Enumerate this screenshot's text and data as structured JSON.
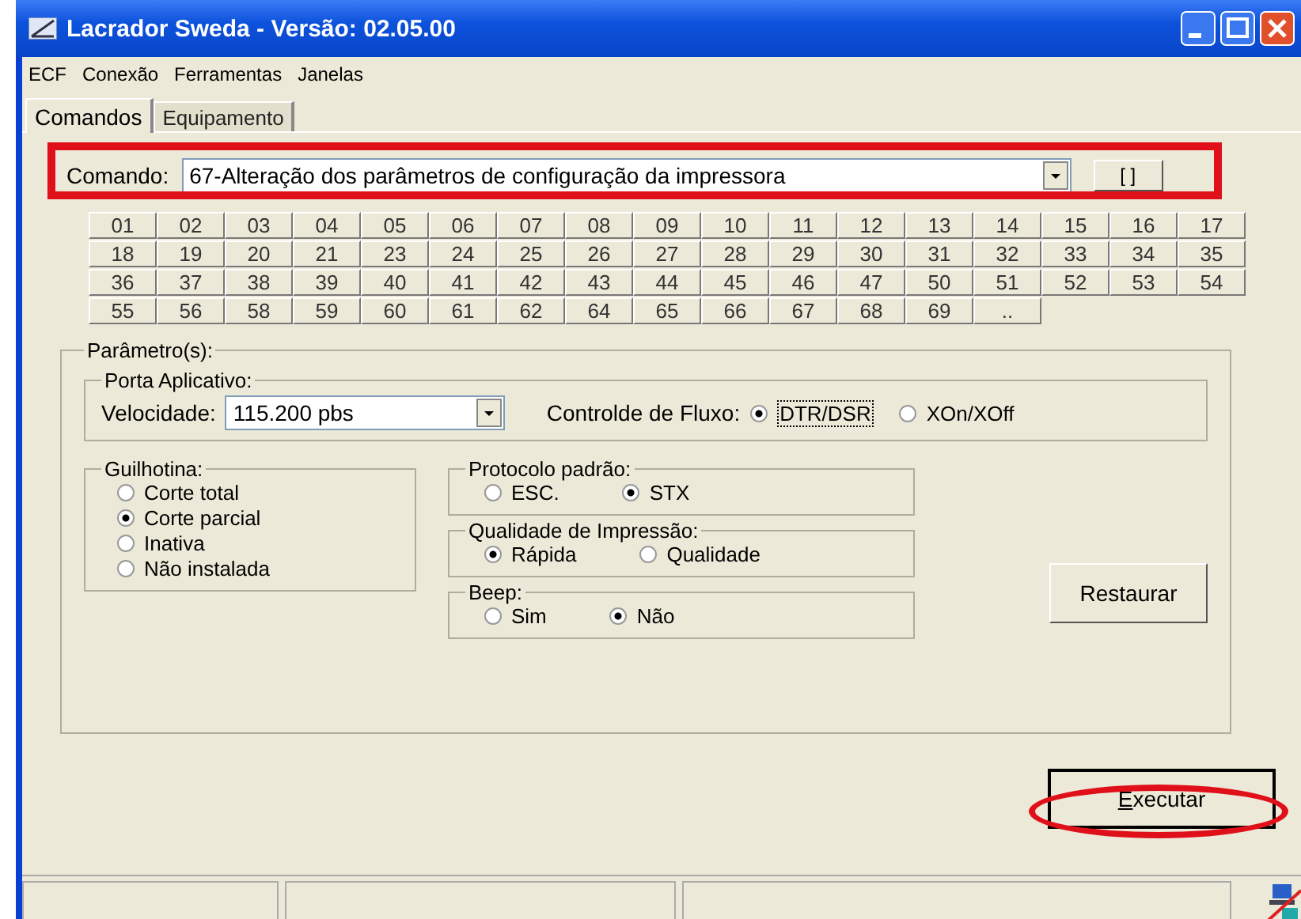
{
  "window": {
    "title": "Lacrador Sweda - Versão: 02.05.00"
  },
  "menu": [
    "ECF",
    "Conexão",
    "Ferramentas",
    "Janelas"
  ],
  "tabs": [
    {
      "label": "Comandos",
      "selected": true
    },
    {
      "label": "Equipamento",
      "selected": false
    }
  ],
  "command": {
    "label": "Comando:",
    "value": "67-Alteração dos parâmetros de configuração da impressora",
    "button": "[ ]"
  },
  "command_buttons": [
    "01",
    "02",
    "03",
    "04",
    "05",
    "06",
    "07",
    "08",
    "09",
    "10",
    "11",
    "12",
    "13",
    "14",
    "15",
    "16",
    "17",
    "18",
    "19",
    "20",
    "21",
    "23",
    "24",
    "25",
    "26",
    "27",
    "28",
    "29",
    "30",
    "31",
    "32",
    "33",
    "34",
    "35",
    "36",
    "37",
    "38",
    "39",
    "40",
    "41",
    "42",
    "43",
    "44",
    "45",
    "46",
    "47",
    "50",
    "51",
    "52",
    "53",
    "54",
    "55",
    "56",
    "58",
    "59",
    "60",
    "61",
    "62",
    "64",
    "65",
    "66",
    "67",
    "68",
    "69",
    ".."
  ],
  "parameters": {
    "title": "Parâmetro(s):",
    "port": {
      "title": "Porta Aplicativo:",
      "speed_label": "Velocidade:",
      "speed_value": "115.200 pbs",
      "flow_label": "Controlde de Fluxo:",
      "flow_options": [
        {
          "label": "DTR/DSR",
          "selected": true
        },
        {
          "label": "XOn/XOff",
          "selected": false
        }
      ]
    },
    "groups": [
      {
        "title": "Guilhotina:",
        "kind": "vertical",
        "options": [
          {
            "label": "Corte total",
            "selected": false
          },
          {
            "label": "Corte parcial",
            "selected": true
          },
          {
            "label": "Inativa",
            "selected": false
          },
          {
            "label": "Não instalada",
            "selected": false
          }
        ]
      },
      {
        "title": "Protocolo padrão:",
        "kind": "horizontal",
        "options": [
          {
            "label": "ESC.",
            "selected": false
          },
          {
            "label": "STX",
            "selected": true
          }
        ]
      },
      {
        "title": "Qualidade de Impressão:",
        "kind": "horizontal",
        "options": [
          {
            "label": "Rápida",
            "selected": true
          },
          {
            "label": "Qualidade",
            "selected": false
          }
        ]
      },
      {
        "title": "Beep:",
        "kind": "horizontal",
        "options": [
          {
            "label": "Sim",
            "selected": false
          },
          {
            "label": "Não",
            "selected": true
          }
        ]
      }
    ],
    "restore_button": "Restaurar"
  },
  "execute_button": "Executar"
}
